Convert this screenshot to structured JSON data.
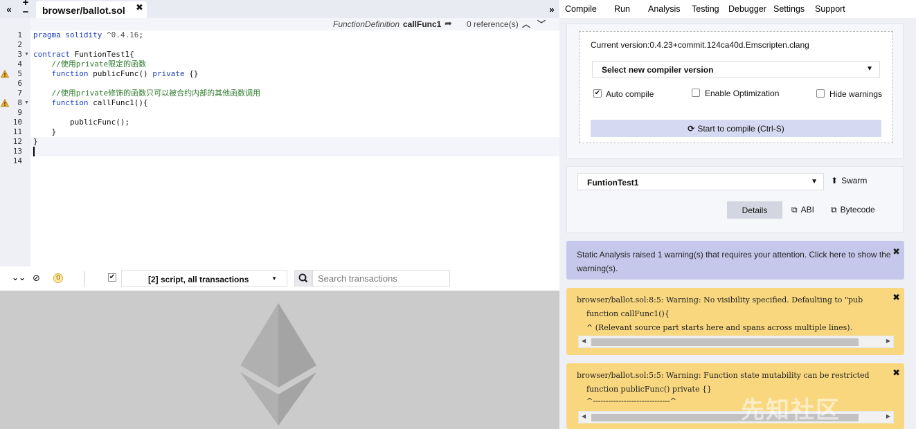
{
  "editor": {
    "tab_title": "browser/ballot.sol",
    "fn_bar": {
      "definition": "FunctionDefinition",
      "name": "callFunc1",
      "references": "0 reference(s)"
    },
    "lines": [
      {
        "n": "1",
        "code": "pragma solidity ^0.4.16;"
      },
      {
        "n": "2",
        "code": ""
      },
      {
        "n": "3",
        "code": "contract FuntionTest1{"
      },
      {
        "n": "4",
        "code": "    //使用private限定的函数"
      },
      {
        "n": "5",
        "code": "    function publicFunc() private {}"
      },
      {
        "n": "6",
        "code": ""
      },
      {
        "n": "7",
        "code": "    //使用private修饰的函数只可以被合约内部的其他函数调用"
      },
      {
        "n": "8",
        "code": "    function callFunc1(){"
      },
      {
        "n": "9",
        "code": ""
      },
      {
        "n": "10",
        "code": "        publicFunc();"
      },
      {
        "n": "11",
        "code": "    }"
      },
      {
        "n": "12",
        "code": "}"
      },
      {
        "n": "13",
        "code": ""
      },
      {
        "n": "14",
        "code": ""
      }
    ]
  },
  "terminal": {
    "pending_count": "0",
    "filter_label": "[2] script, all transactions",
    "search_placeholder": "Search transactions"
  },
  "menu": [
    "Compile",
    "Run",
    "Analysis",
    "Testing",
    "Debugger",
    "Settings",
    "Support"
  ],
  "compile": {
    "current_version": "Current version:0.4.23+commit.124ca40d.Emscripten.clang",
    "select_label": "Select new compiler version",
    "auto_compile": "Auto compile",
    "enable_optimization": "Enable Optimization",
    "hide_warnings": "Hide warnings",
    "compile_button": "Start to compile (Ctrl-S)"
  },
  "contract": {
    "selected": "FuntionTest1",
    "swarm": "Swarm",
    "details": "Details",
    "abi": "ABI",
    "bytecode": "Bytecode"
  },
  "static_alert": "Static Analysis raised 1 warning(s) that requires your attention. Click here to show the warning(s).",
  "warnings": [
    {
      "line1": "browser/ballot.sol:8:5: Warning: No visibility specified. Defaulting to \"pub",
      "line2": "    function callFunc1(){",
      "line3": "    ^ (Relevant source part starts here and spans across multiple lines)."
    },
    {
      "line1": "browser/ballot.sol:5:5: Warning: Function state mutability can be restricted",
      "line2": "    function publicFunc() private {}",
      "line3": "    ^------------------------------^"
    }
  ],
  "watermark": "先知社区",
  "colors": {
    "accent_button": "#d6d9f2",
    "alert_bg": "#c6c8eb",
    "warning_bg": "#f8d77e",
    "terminal_bg": "#cbcbcb"
  }
}
